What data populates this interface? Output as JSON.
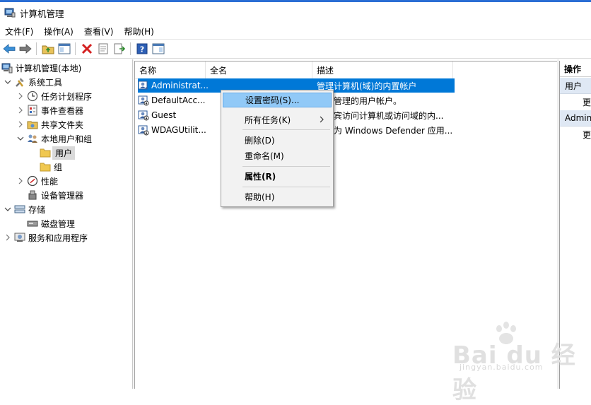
{
  "window": {
    "title": "计算机管理"
  },
  "menubar": [
    "文件(F)",
    "操作(A)",
    "查看(V)",
    "帮助(H)"
  ],
  "toolbar": [
    "back-icon",
    "forward-icon",
    "up-folder-icon",
    "show-pane-icon",
    "delete-icon",
    "properties-icon",
    "export-icon",
    "help-icon",
    "show-action-pane-icon"
  ],
  "tree": {
    "root": "计算机管理(本地)",
    "system_tools": "系统工具",
    "task_scheduler": "任务计划程序",
    "event_viewer": "事件查看器",
    "shared_folders": "共享文件夹",
    "local_users_groups": "本地用户和组",
    "users": "用户",
    "groups": "组",
    "performance": "性能",
    "device_manager": "设备管理器",
    "storage": "存储",
    "disk_management": "磁盘管理",
    "services_apps": "服务和应用程序"
  },
  "list": {
    "columns": [
      "名称",
      "全名",
      "描述"
    ],
    "rows": [
      {
        "name": "Administrat...",
        "fullname": "",
        "desc": "管理计算机(域)的内置帐户"
      },
      {
        "name": "DefaultAcc...",
        "fullname": "",
        "desc": "系统管理的用户帐户。"
      },
      {
        "name": "Guest",
        "fullname": "",
        "desc": "供来宾访问计算机或访问域的内..."
      },
      {
        "name": "WDAGUtilit...",
        "fullname": "",
        "desc": "系统为 Windows Defender 应用..."
      }
    ]
  },
  "context_menu": {
    "set_password": "设置密码(S)...",
    "all_tasks": "所有任务(K)",
    "delete": "删除(D)",
    "rename": "重命名(M)",
    "properties": "属性(R)",
    "help": "帮助(H)"
  },
  "actions": {
    "header": "操作",
    "section1": "用户",
    "item1": "更多操作",
    "section2": "Administrator",
    "item2": "更多操作"
  },
  "watermark": {
    "brand": "Bai du 经验",
    "url": "jingyan.baidu.com"
  }
}
